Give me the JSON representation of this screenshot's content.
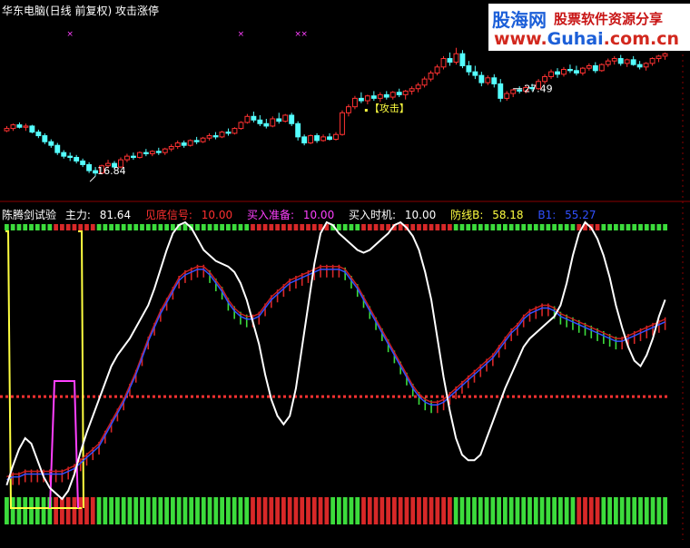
{
  "header": {
    "title": "华东电脑(日线 前复权) 攻击涨停"
  },
  "logo": {
    "brand": "股海网",
    "slogan": "股票软件资源分享",
    "url_prefix": "www.",
    "url_brand": "Guhai",
    "url_suffix": ".com.cn"
  },
  "indicator": {
    "name": "陈腾剑试验",
    "items": [
      {
        "label": "主力:",
        "value": "81.64",
        "color": "#ffffff"
      },
      {
        "label": "见底信号:",
        "value": "10.00",
        "color": "#ff3030"
      },
      {
        "label": "买入准备:",
        "value": "10.00",
        "color": "#ff40ff"
      },
      {
        "label": "买入时机:",
        "value": "10.00",
        "color": "#ffffff"
      },
      {
        "label": "防线B:",
        "value": "58.18",
        "color": "#ffff40"
      },
      {
        "label": "B1:",
        "value": "55.27",
        "color": "#3050ff"
      }
    ]
  },
  "chart_data": [
    {
      "type": "candlestick",
      "annotations": [
        {
          "text": "27.49",
          "kind": "high",
          "index": 80
        },
        {
          "text": "16.84",
          "kind": "low",
          "index": 14
        },
        {
          "text": "【攻击】",
          "kind": "signal",
          "index": 57
        }
      ],
      "ylim": [
        15.5,
        29.5
      ],
      "colors": {
        "up": "#ff3232",
        "down": "#54ffff",
        "marker": "#ff40ff"
      },
      "candles": [
        [
          20.61,
          21.0,
          20.5,
          20.8
        ],
        [
          20.8,
          21.2,
          20.6,
          21.1
        ],
        [
          21.1,
          21.3,
          20.8,
          20.9
        ],
        [
          20.9,
          21.2,
          20.6,
          21.0
        ],
        [
          21.0,
          21.1,
          20.4,
          20.5
        ],
        [
          20.5,
          20.7,
          20.0,
          20.2
        ],
        [
          20.2,
          20.4,
          19.5,
          19.7
        ],
        [
          19.7,
          19.9,
          19.2,
          19.4
        ],
        [
          19.4,
          19.6,
          18.6,
          18.8
        ],
        [
          18.8,
          19.0,
          18.3,
          18.5
        ],
        [
          18.5,
          18.8,
          18.1,
          18.4
        ],
        [
          18.4,
          18.6,
          17.9,
          18.1
        ],
        [
          18.1,
          18.3,
          17.6,
          17.8
        ],
        [
          17.8,
          18.0,
          17.1,
          17.3
        ],
        [
          17.3,
          17.6,
          16.84,
          17.1
        ],
        [
          17.1,
          17.8,
          17.0,
          17.7
        ],
        [
          17.7,
          18.2,
          17.5,
          17.9
        ],
        [
          17.9,
          18.1,
          17.4,
          17.6
        ],
        [
          17.6,
          18.4,
          17.5,
          18.2
        ],
        [
          18.2,
          18.7,
          18.0,
          18.5
        ],
        [
          18.5,
          18.8,
          18.2,
          18.4
        ],
        [
          18.4,
          18.9,
          18.3,
          18.8
        ],
        [
          18.8,
          19.1,
          18.5,
          18.7
        ],
        [
          18.7,
          19.0,
          18.5,
          18.9
        ],
        [
          18.9,
          19.2,
          18.6,
          18.8
        ],
        [
          18.8,
          19.2,
          18.6,
          19.1
        ],
        [
          19.1,
          19.5,
          18.9,
          19.3
        ],
        [
          19.3,
          19.8,
          19.1,
          19.6
        ],
        [
          19.6,
          19.8,
          19.2,
          19.4
        ],
        [
          19.4,
          19.9,
          19.3,
          19.8
        ],
        [
          19.8,
          20.1,
          19.5,
          19.7
        ],
        [
          19.7,
          20.1,
          19.6,
          20.0
        ],
        [
          20.0,
          20.4,
          19.8,
          20.2
        ],
        [
          20.2,
          20.5,
          19.9,
          20.1
        ],
        [
          20.1,
          20.6,
          20.0,
          20.5
        ],
        [
          20.5,
          20.8,
          20.2,
          20.4
        ],
        [
          20.4,
          20.9,
          20.3,
          20.8
        ],
        [
          20.8,
          21.4,
          20.7,
          21.3
        ],
        [
          21.3,
          22.0,
          21.2,
          21.8
        ],
        [
          21.8,
          22.2,
          21.3,
          21.5
        ],
        [
          21.5,
          21.9,
          21.0,
          21.2
        ],
        [
          21.2,
          21.6,
          20.8,
          21.0
        ],
        [
          21.0,
          21.8,
          20.9,
          21.6
        ],
        [
          21.6,
          22.1,
          21.2,
          21.4
        ],
        [
          21.4,
          22.0,
          21.3,
          21.9
        ],
        [
          21.9,
          22.1,
          21.0,
          21.2
        ],
        [
          21.2,
          21.4,
          19.8,
          20.1
        ],
        [
          20.1,
          20.3,
          19.4,
          19.6
        ],
        [
          19.6,
          20.3,
          19.5,
          20.2
        ],
        [
          20.2,
          20.4,
          19.6,
          19.8
        ],
        [
          19.8,
          20.3,
          19.7,
          20.1
        ],
        [
          20.1,
          20.4,
          19.8,
          19.9
        ],
        [
          19.9,
          20.5,
          19.8,
          20.3
        ],
        [
          20.3,
          22.3,
          20.2,
          22.1
        ],
        [
          22.1,
          22.8,
          21.8,
          22.6
        ],
        [
          22.6,
          23.5,
          22.4,
          23.3
        ],
        [
          23.3,
          23.8,
          22.9,
          23.1
        ],
        [
          23.1,
          23.6,
          22.8,
          23.5
        ],
        [
          23.5,
          23.9,
          23.1,
          23.3
        ],
        [
          23.3,
          23.8,
          23.0,
          23.6
        ],
        [
          23.6,
          23.9,
          23.2,
          23.4
        ],
        [
          23.4,
          23.9,
          23.2,
          23.8
        ],
        [
          23.8,
          24.1,
          23.4,
          23.6
        ],
        [
          23.6,
          24.0,
          23.2,
          23.9
        ],
        [
          23.9,
          24.3,
          23.6,
          24.1
        ],
        [
          24.1,
          24.6,
          23.8,
          24.4
        ],
        [
          24.4,
          25.1,
          24.2,
          24.9
        ],
        [
          24.9,
          25.6,
          24.7,
          25.4
        ],
        [
          25.4,
          26.1,
          25.2,
          25.9
        ],
        [
          25.9,
          26.8,
          25.7,
          26.6
        ],
        [
          26.6,
          27.1,
          26.0,
          26.3
        ],
        [
          26.3,
          27.49,
          26.1,
          27.0
        ],
        [
          27.0,
          27.3,
          25.8,
          26.0
        ],
        [
          26.0,
          26.4,
          25.2,
          25.5
        ],
        [
          25.5,
          26.0,
          24.9,
          25.2
        ],
        [
          25.2,
          25.5,
          24.3,
          24.6
        ],
        [
          24.6,
          25.2,
          24.4,
          25.0
        ],
        [
          25.0,
          25.3,
          24.2,
          24.5
        ],
        [
          24.5,
          24.9,
          23.0,
          23.3
        ],
        [
          23.3,
          23.9,
          23.1,
          23.7
        ],
        [
          23.7,
          24.1,
          23.4,
          24.0
        ],
        [
          24.0,
          24.3,
          23.7,
          23.9
        ],
        [
          23.9,
          24.4,
          23.7,
          24.2
        ],
        [
          24.2,
          24.5,
          23.9,
          24.1
        ],
        [
          24.1,
          24.9,
          24.0,
          24.7
        ],
        [
          24.7,
          25.3,
          24.5,
          25.1
        ],
        [
          25.1,
          25.7,
          24.9,
          25.5
        ],
        [
          25.5,
          25.8,
          25.0,
          25.3
        ],
        [
          25.3,
          25.9,
          25.1,
          25.7
        ],
        [
          25.7,
          26.1,
          25.4,
          25.6
        ],
        [
          25.6,
          26.0,
          25.2,
          25.4
        ],
        [
          25.4,
          25.9,
          25.2,
          25.8
        ],
        [
          25.8,
          26.2,
          25.6,
          26.0
        ],
        [
          26.0,
          26.3,
          25.4,
          25.6
        ],
        [
          25.6,
          26.2,
          25.5,
          26.1
        ],
        [
          26.1,
          26.6,
          25.9,
          26.4
        ],
        [
          26.4,
          26.8,
          26.1,
          26.6
        ],
        [
          26.6,
          26.9,
          26.0,
          26.2
        ],
        [
          26.2,
          26.6,
          25.9,
          26.5
        ],
        [
          26.5,
          26.8,
          26.0,
          26.1
        ],
        [
          26.1,
          26.4,
          25.7,
          25.9
        ],
        [
          25.9,
          26.3,
          25.6,
          26.2
        ],
        [
          26.2,
          26.7,
          26.0,
          26.6
        ],
        [
          26.6,
          26.9,
          26.3,
          26.8
        ],
        [
          26.8,
          27.1,
          26.5,
          27.0
        ]
      ],
      "markers": [
        10,
        37,
        46,
        47,
        79,
        81,
        88,
        90
      ]
    },
    {
      "type": "line",
      "ylim": [
        0,
        100
      ],
      "reference_lines": [
        {
          "value": 37,
          "color": "#ff3232"
        }
      ],
      "series": [
        {
          "name": "主力",
          "color": "#ffffff",
          "values": [
            5,
            12,
            18,
            22,
            20,
            14,
            8,
            4,
            2,
            0,
            3,
            9,
            17,
            24,
            30,
            36,
            42,
            48,
            52,
            55,
            58,
            62,
            66,
            70,
            76,
            83,
            90,
            96,
            99,
            100,
            98,
            94,
            90,
            88,
            86,
            85,
            84,
            82,
            78,
            72,
            64,
            56,
            45,
            36,
            30,
            27,
            30,
            40,
            55,
            70,
            85,
            96,
            100,
            99,
            96,
            94,
            92,
            90,
            89,
            90,
            92,
            94,
            96,
            99,
            100,
            98,
            95,
            90,
            82,
            72,
            58,
            44,
            32,
            22,
            16,
            14,
            14,
            16,
            22,
            28,
            34,
            40,
            45,
            50,
            55,
            58,
            60,
            62,
            64,
            66,
            70,
            78,
            88,
            96,
            100,
            98,
            94,
            88,
            80,
            70,
            62,
            55,
            50,
            48,
            52,
            58,
            66,
            72
          ]
        },
        {
          "name": "防线B",
          "color": "#c81e1e",
          "values": [
            8,
            9,
            9,
            10,
            10,
            10,
            10,
            10,
            10,
            10,
            11,
            12,
            14,
            16,
            18,
            20,
            24,
            28,
            32,
            36,
            41,
            46,
            52,
            58,
            63,
            68,
            72,
            76,
            80,
            82,
            83,
            84,
            84,
            82,
            79,
            76,
            72,
            69,
            67,
            66,
            66,
            67,
            70,
            73,
            75,
            77,
            79,
            80,
            81,
            82,
            83,
            84,
            84,
            84,
            84,
            83,
            80,
            77,
            73,
            69,
            65,
            61,
            57,
            53,
            49,
            45,
            41,
            38,
            36,
            35,
            35,
            36,
            38,
            40,
            42,
            44,
            46,
            48,
            50,
            52,
            55,
            58,
            61,
            63,
            66,
            68,
            69,
            70,
            70,
            69,
            67,
            66,
            65,
            64,
            63,
            62,
            61,
            60,
            59,
            58,
            58,
            59,
            60,
            61,
            62,
            63,
            64,
            65
          ]
        },
        {
          "name": "B1",
          "color": "#3250ff",
          "values": [
            7,
            8,
            8,
            9,
            9,
            9,
            9,
            9,
            9,
            9,
            10,
            11,
            13,
            15,
            17,
            19,
            23,
            27,
            31,
            35,
            40,
            45,
            51,
            57,
            62,
            67,
            71,
            75,
            79,
            81,
            82,
            83,
            83,
            81,
            78,
            75,
            71,
            68,
            66,
            65,
            65,
            66,
            69,
            72,
            74,
            76,
            78,
            79,
            80,
            81,
            82,
            83,
            83,
            83,
            83,
            82,
            79,
            76,
            72,
            68,
            64,
            60,
            56,
            52,
            48,
            44,
            40,
            37,
            35,
            34,
            34,
            35,
            37,
            39,
            41,
            43,
            45,
            47,
            49,
            51,
            54,
            57,
            60,
            62,
            65,
            67,
            68,
            69,
            69,
            68,
            66,
            65,
            64,
            63,
            62,
            61,
            60,
            59,
            58,
            57,
            57,
            58,
            59,
            60,
            61,
            62,
            63,
            64
          ]
        },
        {
          "name": "买入准备",
          "color": "#ff40ff",
          "values": [
            0,
            0,
            0,
            0,
            0,
            0,
            0,
            0,
            0,
            0,
            0,
            0,
            0,
            0,
            0,
            0,
            0,
            0,
            0,
            0,
            0,
            0,
            0,
            0,
            0,
            0,
            0,
            0,
            0,
            0,
            0,
            0,
            0,
            0,
            0,
            0,
            0,
            0,
            0,
            0,
            0,
            0,
            0,
            0,
            0,
            0,
            0,
            0,
            0,
            0,
            0,
            0,
            0,
            0,
            0,
            0,
            0,
            0,
            0,
            0,
            0,
            0,
            0,
            0,
            0,
            0,
            0,
            0,
            0,
            0,
            0,
            0,
            0,
            0,
            0,
            0,
            0,
            0,
            0,
            0,
            0,
            0,
            0,
            0,
            0,
            0,
            0,
            0,
            0,
            0,
            0,
            0,
            0,
            0,
            0,
            0,
            0,
            0,
            0,
            0,
            0,
            0,
            0,
            0,
            0,
            0,
            0,
            0
          ]
        },
        {
          "name": "见底信号",
          "color": "#ffff40",
          "values": [
            0,
            0,
            0,
            0,
            0,
            0,
            0,
            0,
            0,
            0,
            0,
            0,
            0,
            0,
            0,
            0,
            0,
            0,
            0,
            0,
            0,
            0,
            0,
            0,
            0,
            0,
            0,
            0,
            0,
            0,
            0,
            0,
            0,
            0,
            0,
            0,
            0,
            0,
            0,
            0,
            0,
            0,
            0,
            0,
            0,
            0,
            0,
            0,
            0,
            0,
            0,
            0,
            0,
            0,
            0,
            0,
            0,
            0,
            0,
            0,
            0,
            0,
            0,
            0,
            0,
            0,
            0,
            0,
            0,
            0,
            0,
            0,
            0,
            0,
            0,
            0,
            0,
            0,
            0,
            0,
            0,
            0,
            0,
            0,
            0,
            0,
            0,
            0,
            0,
            0,
            0,
            0,
            0,
            0,
            0,
            0,
            0,
            0,
            0,
            0,
            0,
            0,
            0,
            0,
            0,
            0,
            0,
            0
          ]
        }
      ],
      "signal_bars": {
        "colors": {
          "bull": "#3cdc3c",
          "bear": "#d82828"
        },
        "states": "GGGGGGGGRRRRRRRGGGGGGGGGGGGGGGGGGGGGGGGGRRRRRRRRRRRRRGGGGGRRRRRRRRRRRRRRRGGGGGGGGGGGGGGGGGGGGRRRRGGGGGGGGGGGG"
      }
    }
  ]
}
